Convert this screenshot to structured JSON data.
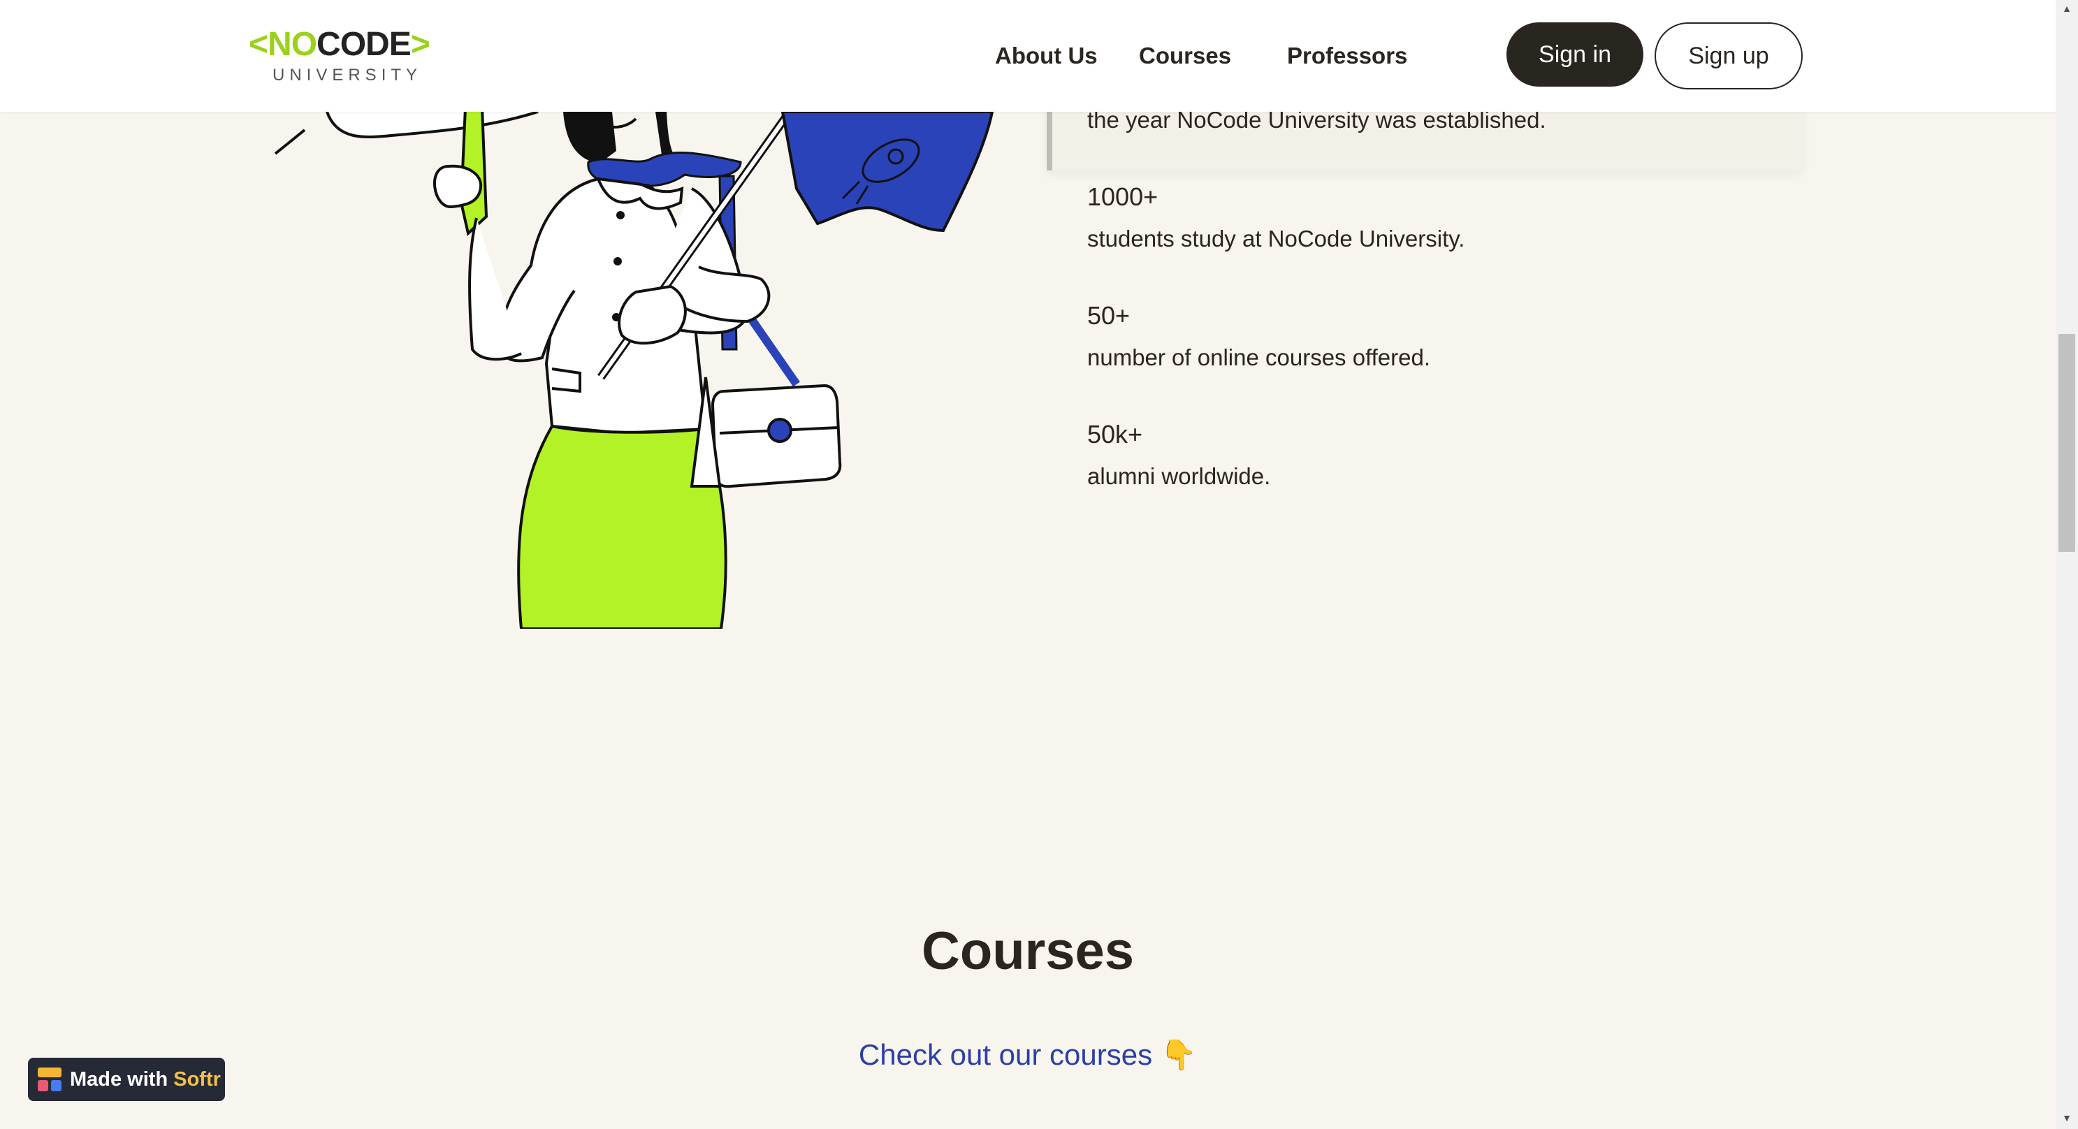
{
  "logo": {
    "bracket_left": "<",
    "no": "NO",
    "code": "CODE",
    "bracket_right": ">",
    "sub": "UNIVERSITY"
  },
  "nav": {
    "items": [
      {
        "label": "About Us"
      },
      {
        "label": "Courses"
      },
      {
        "label": "Professors"
      }
    ],
    "sign_in": "Sign in",
    "sign_up": "Sign up"
  },
  "stats": {
    "first_desc": "the year NoCode University was established.",
    "items": [
      {
        "value": "1000+",
        "desc": "students study at NoCode University."
      },
      {
        "value": "50+",
        "desc": "number of online courses offered."
      },
      {
        "value": "50k+",
        "desc": "alumni worldwide."
      }
    ]
  },
  "courses": {
    "title": "Courses",
    "subtitle": "Check out our courses 👇"
  },
  "badge": {
    "made_with": "Made with",
    "brand": "Softr"
  },
  "colors": {
    "accent_green": "#b2f226",
    "accent_blue": "#2b43b8",
    "dark": "#29251f",
    "background": "#f7f5ee",
    "link_blue": "#2b3fa5"
  },
  "icons": {
    "badge_icon": "softr-logo-icon",
    "scroll_up": "scroll-up-arrow-icon",
    "scroll_down": "scroll-down-arrow-icon"
  }
}
